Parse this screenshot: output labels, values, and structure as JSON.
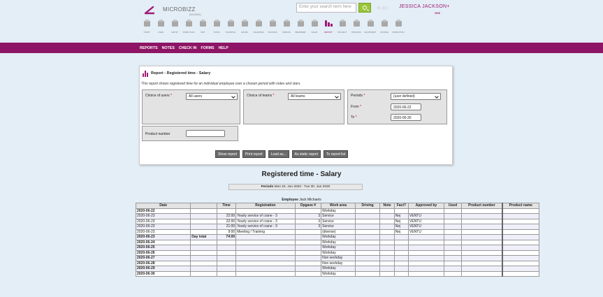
{
  "header": {
    "logo_text": "MICROBIZZ",
    "logo_sub": "(001/0001)",
    "search_placeholder": "Enter your search term here",
    "user_name": "JESSICA JACKSON+",
    "user_sub": "2026",
    "header_icons": "≡ ◁ ▷",
    "toolbar": [
      {
        "label": "Start",
        "icon": "home-icon"
      },
      {
        "label": "User",
        "icon": "user-icon"
      },
      {
        "label": "Setup",
        "icon": "gear-icon"
      },
      {
        "label": "Work plan",
        "icon": "workplan-icon"
      },
      {
        "label": "CRP",
        "icon": "calendar-grid-icon"
      },
      {
        "label": "Tasks",
        "icon": "clipboard-icon"
      },
      {
        "label": "Planning",
        "icon": "planning-icon"
      },
      {
        "label": "Hours",
        "icon": "clock-icon"
      },
      {
        "label": "Calendar",
        "icon": "calendar-icon"
      },
      {
        "label": "Invoices",
        "icon": "invoice-icon"
      },
      {
        "label": "Person",
        "icon": "person-icon"
      },
      {
        "label": "Reminder",
        "icon": "reminder-icon"
      },
      {
        "label": "Sales",
        "icon": "handshake-icon"
      },
      {
        "label": "Report",
        "icon": "bar-chart-icon"
      },
      {
        "label": "Project",
        "icon": "list-icon"
      },
      {
        "label": "Process",
        "icon": "process-icon"
      },
      {
        "label": "Equipment",
        "icon": "tools-icon"
      },
      {
        "label": "Course",
        "icon": "course-icon"
      },
      {
        "label": "Inspection",
        "icon": "magnifier-icon"
      }
    ]
  },
  "menu": [
    "REPORTS",
    "NOTES",
    "CHECK IN",
    "FORMS",
    "HELP"
  ],
  "panel": {
    "title": "Report - Registered time - Salary",
    "description": "This report shows registered time for an individual employee over a chosen period with notes and stars.",
    "users_label": "Choice of users",
    "users_value": "All users",
    "teams_label": "Choice of teams",
    "teams_value": "All teams",
    "periods_label": "Periods",
    "periods_value": "(user defined)",
    "from_label": "From",
    "from_value": "2020-06-22",
    "to_label": "To",
    "to_value": "2020-06-30",
    "product_label": "Product number",
    "product_value": "",
    "required_mark": "*",
    "buttons": [
      "Show report",
      "Print report",
      "Load as...",
      "As static report",
      "To report list"
    ]
  },
  "report": {
    "title": "Registered time - Salary",
    "period_label": "Periods",
    "period_value": "Mon 22. Jun 2020 - Tue 30. Jun 2020",
    "employee_label": "Employee",
    "employee_value": "Jack Michaels",
    "columns": [
      "Date",
      "",
      "Time",
      "Registration",
      "Opgave #",
      "Work area",
      "Driving",
      "Note",
      "Fact?",
      "Approved by",
      "Used",
      "Product number",
      "Product name"
    ],
    "rows": [
      {
        "date": "2020-06-22",
        "bold": true,
        "c2": "",
        "time": "",
        "reg": "",
        "op": "",
        "area": "Workday",
        "fact": "",
        "appr": ""
      },
      {
        "date": "2020-06-23",
        "bold": false,
        "c2": "",
        "time": "22:00",
        "reg": "Yearly service of crane - 3",
        "op": "3",
        "area": "Service",
        "fact": "Nej",
        "appr": "VENTU"
      },
      {
        "date": "2020-06-23",
        "bold": false,
        "c2": "",
        "time": "22:00",
        "reg": "Yearly service of crane - 3",
        "op": "3",
        "area": "Service",
        "fact": "Nej",
        "appr": "VENTU"
      },
      {
        "date": "2020-06-23",
        "bold": false,
        "c2": "",
        "time": "21:00",
        "reg": "Yearly service of crane - 3",
        "op": "3",
        "area": "Service",
        "fact": "Nej",
        "appr": "VENTU"
      },
      {
        "date": "2020-06-23",
        "bold": false,
        "c2": "",
        "time": "9:00",
        "reg": "Meeting / Training",
        "op": "",
        "area": "(diverse)",
        "fact": "Nej",
        "appr": "VENTU"
      },
      {
        "date": "2020-06-23",
        "bold": true,
        "c2": "Day total",
        "time": "74:00",
        "reg": "",
        "op": "",
        "area": "Workday",
        "fact": "",
        "appr": ""
      },
      {
        "date": "2020-06-24",
        "bold": true,
        "c2": "",
        "time": "",
        "reg": "",
        "op": "",
        "area": "Workday",
        "fact": "",
        "appr": ""
      },
      {
        "date": "2020-06-25",
        "bold": true,
        "c2": "",
        "time": "",
        "reg": "",
        "op": "",
        "area": "Workday",
        "fact": "",
        "appr": ""
      },
      {
        "date": "2020-06-26",
        "bold": true,
        "c2": "",
        "time": "",
        "reg": "",
        "op": "",
        "area": "Workday",
        "fact": "",
        "appr": ""
      },
      {
        "date": "2020-06-27",
        "bold": true,
        "c2": "",
        "time": "",
        "reg": "",
        "op": "",
        "area": "Non workday",
        "fact": "",
        "appr": ""
      },
      {
        "date": "2020-06-28",
        "bold": true,
        "c2": "",
        "time": "",
        "reg": "",
        "op": "",
        "area": "Non workday",
        "fact": "",
        "appr": ""
      },
      {
        "date": "2020-06-29",
        "bold": true,
        "c2": "",
        "time": "",
        "reg": "",
        "op": "",
        "area": "Workday",
        "fact": "",
        "appr": ""
      },
      {
        "date": "2020-06-30",
        "bold": true,
        "c2": "",
        "time": "",
        "reg": "",
        "op": "",
        "area": "Workday",
        "fact": "",
        "appr": ""
      }
    ]
  },
  "colors": {
    "brand": "#8e1565",
    "accent": "#9ac53a",
    "page_bg": "#e4eef6"
  }
}
